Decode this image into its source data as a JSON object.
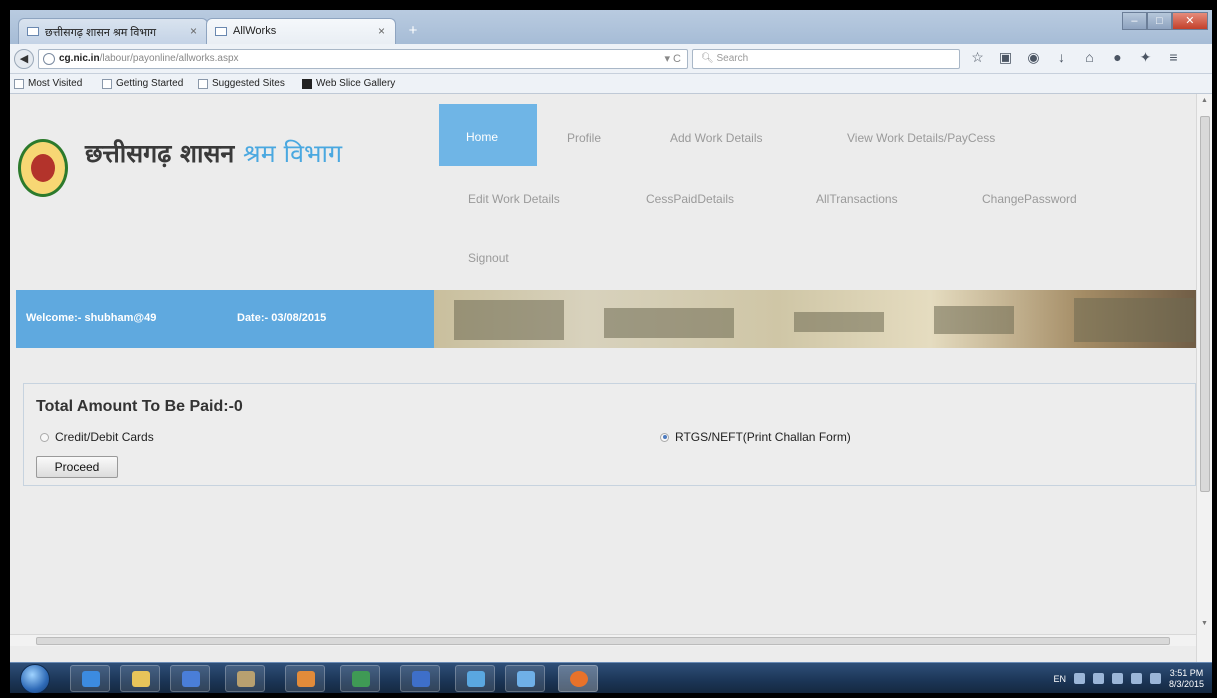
{
  "browser": {
    "tabs": [
      {
        "title": "छत्तीसगढ़ शासन श्रम विभाग",
        "active": false
      },
      {
        "title": "AllWorks",
        "active": true
      }
    ],
    "new_tab": "+",
    "url_host": "cg.nic.in",
    "url_path": "/labour/payonline/allworks.aspx",
    "search_placeholder": "Search",
    "bookmarks": [
      "Most Visited",
      "Getting Started",
      "Suggested Sites",
      "Web Slice Gallery"
    ]
  },
  "site": {
    "logo_main": "छत्तीसगढ़ शासन",
    "logo_dept": "श्रम विभाग",
    "menu": {
      "home": "Home",
      "profile": "Profile",
      "add_work": "Add Work Details",
      "view_work": "View Work Details/PayCess",
      "edit_work": "Edit Work Details",
      "cess_paid": "CessPaidDetails",
      "all_transactions": "AllTransactions",
      "change_password": "ChangePassword",
      "signout": "Signout"
    },
    "welcome": "Welcome:- shubham@49",
    "date": "Date:- 03/08/2015"
  },
  "payment": {
    "total_label": "Total Amount To Be Paid:-0",
    "options": [
      {
        "label": "Credit/Debit Cards",
        "selected": false
      },
      {
        "label": "RTGS/NEFT(Print Challan Form)",
        "selected": true
      }
    ],
    "proceed_label": "Proceed"
  },
  "taskbar": {
    "lang": "EN",
    "time": "3:51 PM",
    "date": "8/3/2015"
  },
  "colors": {
    "accent": "#6fb5e6",
    "welcome_bar": "#5fa9df",
    "logo_blue": "#4aa8e0"
  }
}
